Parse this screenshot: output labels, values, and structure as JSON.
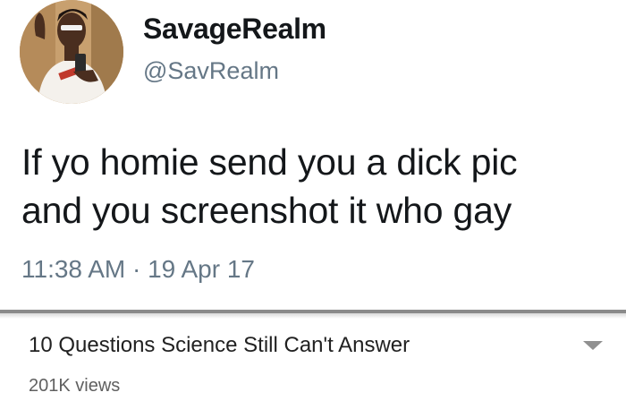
{
  "tweet": {
    "display_name": "SavageRealm",
    "handle": "@SavRealm",
    "text_line1": "If yo homie send you a dick pic",
    "text_line2": "and you screenshot it who gay",
    "timestamp": "11:38 AM · 19 Apr 17"
  },
  "video": {
    "title": "10 Questions Science Still Can't Answer",
    "views": "201K views",
    "expand_icon": "chevron-down-icon"
  },
  "colors": {
    "text_primary": "#14171a",
    "text_secondary": "#657786",
    "video_title": "#212121",
    "video_meta": "#606060"
  }
}
